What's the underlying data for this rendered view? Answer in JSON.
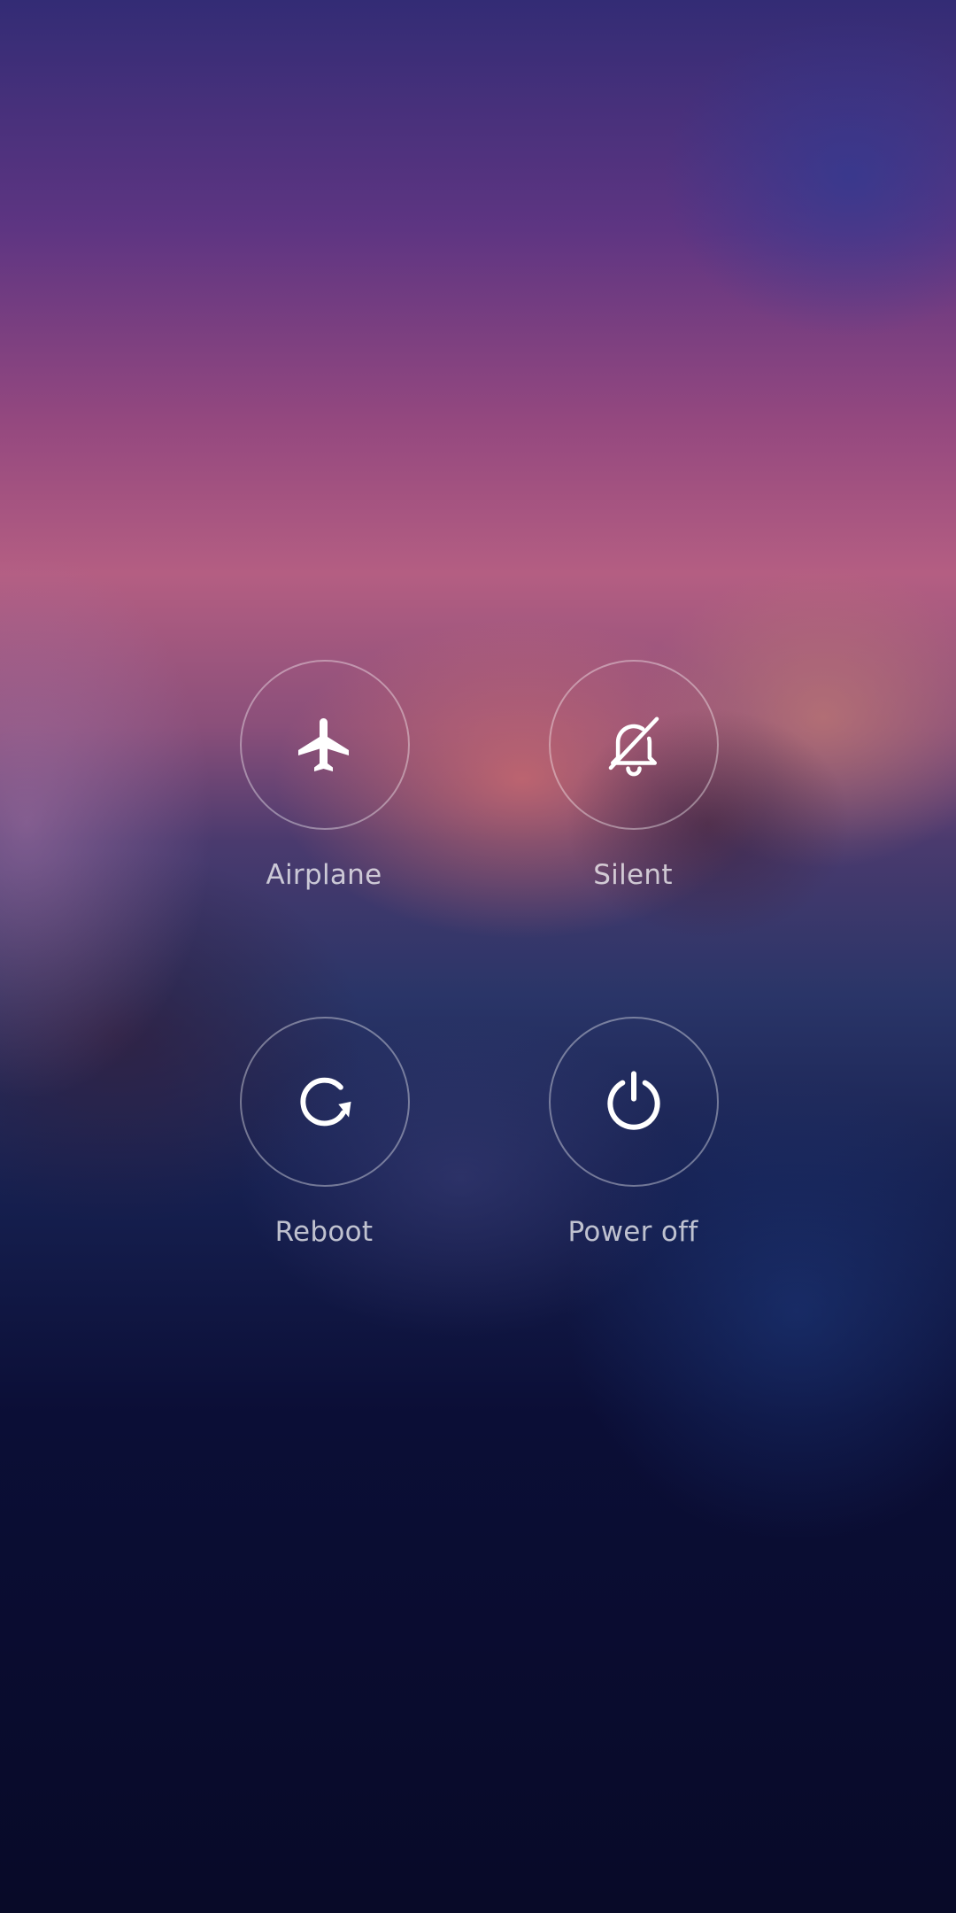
{
  "power_menu": {
    "actions": [
      {
        "id": "airplane",
        "label": "Airplane",
        "icon": "airplane-icon"
      },
      {
        "id": "silent",
        "label": "Silent",
        "icon": "bell-off-icon"
      },
      {
        "id": "reboot",
        "label": "Reboot",
        "icon": "reboot-icon"
      },
      {
        "id": "power_off",
        "label": "Power off",
        "icon": "power-icon"
      }
    ]
  },
  "colors": {
    "icon": "#ffffff",
    "label": "#d9d3e3",
    "circle_border": "#ffffff"
  }
}
